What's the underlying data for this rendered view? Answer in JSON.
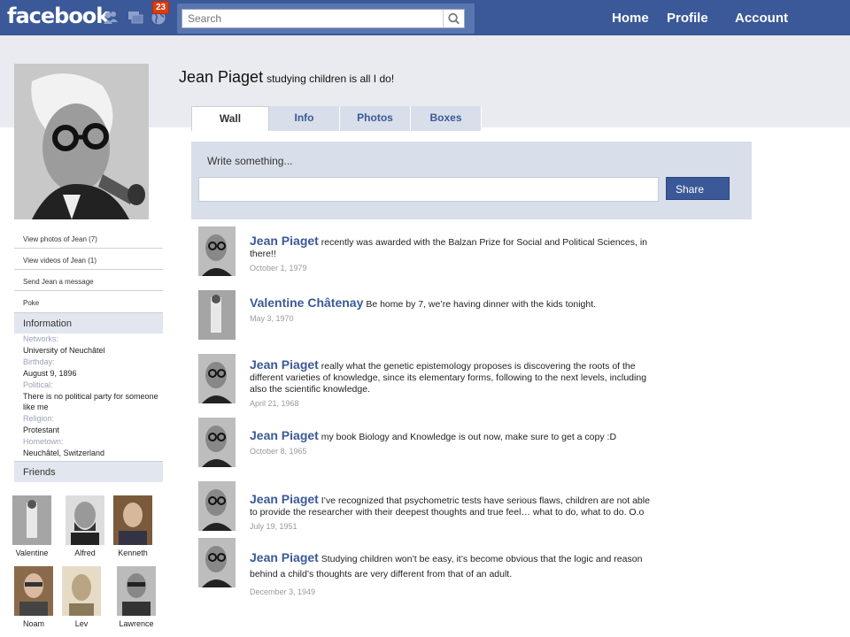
{
  "topbar": {
    "logo": "facebook",
    "notification_count": "23",
    "search_placeholder": "Search",
    "nav": {
      "home": "Home",
      "profile": "Profile",
      "account": "Account"
    }
  },
  "profile": {
    "name": "Jean Piaget",
    "status": "studying children is all I do!"
  },
  "tabs": [
    "Wall",
    "Info",
    "Photos",
    "Boxes"
  ],
  "publisher": {
    "label": "Write something...",
    "share": "Share"
  },
  "sidebar": {
    "links": [
      "View photos of Jean (7)",
      "View videos of Jean (1)",
      "Send Jean a message",
      "Poke"
    ],
    "info_header": "Information",
    "info": [
      {
        "key": "Networks:",
        "value": "University of Neuchâtel"
      },
      {
        "key": "Birthday:",
        "value": "August 9, 1896"
      },
      {
        "key": "Political:",
        "value": "There is no political party for someone like me"
      },
      {
        "key": "Religion:",
        "value": "Protestant"
      },
      {
        "key": "Hometown:",
        "value": "Neuchâtel, Switzerland"
      }
    ],
    "friends_header": "Friends",
    "friends": [
      "Valentine",
      "Alfred",
      "Kenneth",
      "Noam",
      "Lev",
      "Lawrence"
    ]
  },
  "posts": [
    {
      "author": "Jean Piaget",
      "text": "recently was awarded with the Balzan Prize for Social and Political Sciences, in there!!",
      "date": "October 1, 1979"
    },
    {
      "author": "Valentine  Châtenay",
      "text": "Be home by 7, we’re having dinner with the kids tonight.",
      "date": "May 3, 1970"
    },
    {
      "author": "Jean Piaget",
      "text": "really what the genetic epistemology proposes is discovering the roots of the different varieties of knowledge, since its elementary forms, following to the next levels, including also the scientific knowledge.",
      "date": "April 21, 1968"
    },
    {
      "author": "Jean Piaget",
      "text": "my book Biology and Knowledge is out now, make sure to get a copy :D",
      "date": "October 8, 1965"
    },
    {
      "author": "Jean Piaget",
      "text": "I’ve recognized that psychometric tests have serious flaws, children are not able to provide the researcher with their deepest thoughts and true feel… what to do, what to do. O.o",
      "date": "July 19, 1951"
    },
    {
      "author": "Jean Piaget",
      "text": "Studying children won’t be easy, it’s become obvious that the logic and reason behind a child’s thoughts are very different from that of an adult.",
      "date": "December 3, 1949"
    }
  ]
}
